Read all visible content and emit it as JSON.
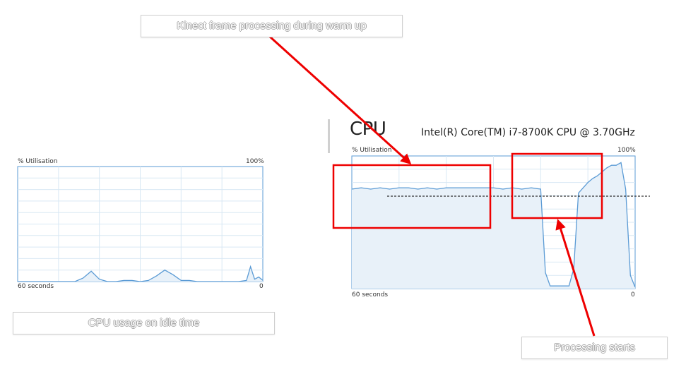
{
  "callouts": {
    "warmup": "Kinect frame processing during warm up",
    "idle": "CPU usage on idle time",
    "processing": "Processing starts"
  },
  "idle_panel": {
    "utilisation_label": "% Utilisation",
    "max_label": "100%",
    "time_label": "60 seconds",
    "min_label": "0"
  },
  "cpu_panel": {
    "title": "CPU",
    "model": "Intel(R) Core(TM) i7-8700K CPU @ 3.70GHz",
    "utilisation_label": "% Utilisation",
    "max_label": "100%",
    "time_label": "60 seconds",
    "min_label": "0"
  },
  "colors": {
    "graph_line": "#5b9bd5",
    "graph_fill": "#e8f1f9",
    "grid": "#d9e8f4",
    "annotation": "#ee0000"
  },
  "chart_data": [
    {
      "type": "area",
      "x_range": [
        60,
        0
      ],
      "ylim": [
        0,
        100
      ],
      "x": [
        60,
        58,
        56,
        54,
        52,
        50,
        48,
        46,
        44,
        42,
        40,
        38,
        36,
        34,
        32,
        30,
        28,
        26,
        24,
        22,
        20,
        18,
        16,
        14,
        12,
        10,
        8,
        6,
        4,
        3,
        2,
        1,
        0
      ],
      "values": [
        0,
        0,
        0,
        0,
        0,
        0,
        0,
        0,
        3,
        9,
        2,
        0,
        0,
        1,
        1,
        0,
        1,
        5,
        10,
        6,
        1,
        1,
        0,
        0,
        0,
        0,
        0,
        0,
        1,
        13,
        2,
        4,
        1
      ]
    },
    {
      "type": "area",
      "x_range": [
        60,
        0
      ],
      "ylim": [
        0,
        100
      ],
      "x": [
        60,
        58,
        56,
        54,
        52,
        50,
        48,
        46,
        44,
        42,
        40,
        38,
        36,
        34,
        32,
        30,
        28,
        26,
        24,
        22,
        20,
        19,
        18,
        16,
        14,
        13,
        12,
        11,
        10,
        9,
        8,
        7,
        6,
        5,
        4,
        3,
        2,
        1,
        0
      ],
      "values": [
        75,
        76,
        75,
        76,
        75,
        76,
        76,
        75,
        76,
        75,
        76,
        76,
        76,
        76,
        76,
        76,
        75,
        76,
        75,
        76,
        75,
        12,
        2,
        2,
        2,
        15,
        72,
        76,
        80,
        83,
        85,
        88,
        91,
        93,
        93,
        95,
        75,
        10,
        1
      ]
    }
  ]
}
